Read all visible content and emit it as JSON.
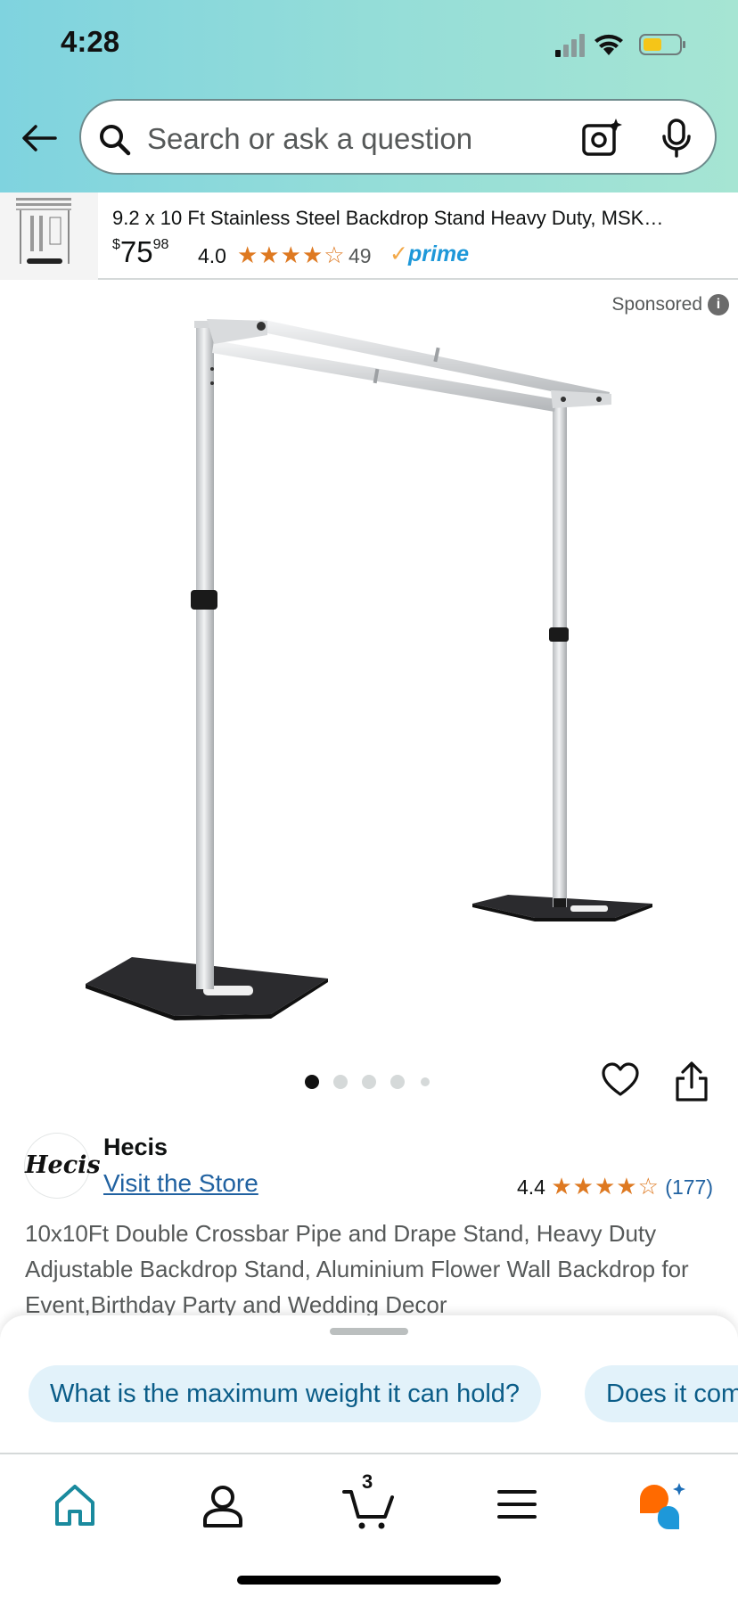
{
  "status_bar": {
    "time": "4:28"
  },
  "search": {
    "placeholder": "Search or ask a question"
  },
  "sponsored_product": {
    "title": "9.2 x 10 Ft Stainless Steel Backdrop Stand Heavy Duty, MSK…",
    "price_currency": "$",
    "price_whole": "75",
    "price_fraction": "98",
    "rating": "4.0",
    "stars": "★★★★☆",
    "review_count": "49",
    "prime_label": "prime",
    "prime_check": "✓"
  },
  "sponsored_label": "Sponsored",
  "image_carousel": {
    "dot_count": 5,
    "active_index": 0
  },
  "store": {
    "logo_text": "Hecis",
    "name": "Hecis",
    "visit_link": "Visit the Store",
    "rating": "4.4",
    "stars": "★★★★☆",
    "review_count": "(177)"
  },
  "product": {
    "description": "10x10Ft Double Crossbar Pipe and Drape Stand, Heavy Duty Adjustable Backdrop Stand, Aluminium Flower Wall Backdrop for Event,Birthday Party and Wedding Decor"
  },
  "suggestions": [
    "What is the maximum weight it can hold?",
    "Does it come with..."
  ],
  "bottom_nav": {
    "items": [
      "home",
      "account",
      "cart",
      "menu",
      "rufus"
    ],
    "cart_count": "3",
    "active": "home"
  },
  "colors": {
    "header_gradient_start": "#7fd3df",
    "header_gradient_end": "#a6e5d3",
    "star": "#de7921",
    "link": "#2162a1",
    "prime": "#1e98d9",
    "active_nav": "#1a8a9e"
  }
}
